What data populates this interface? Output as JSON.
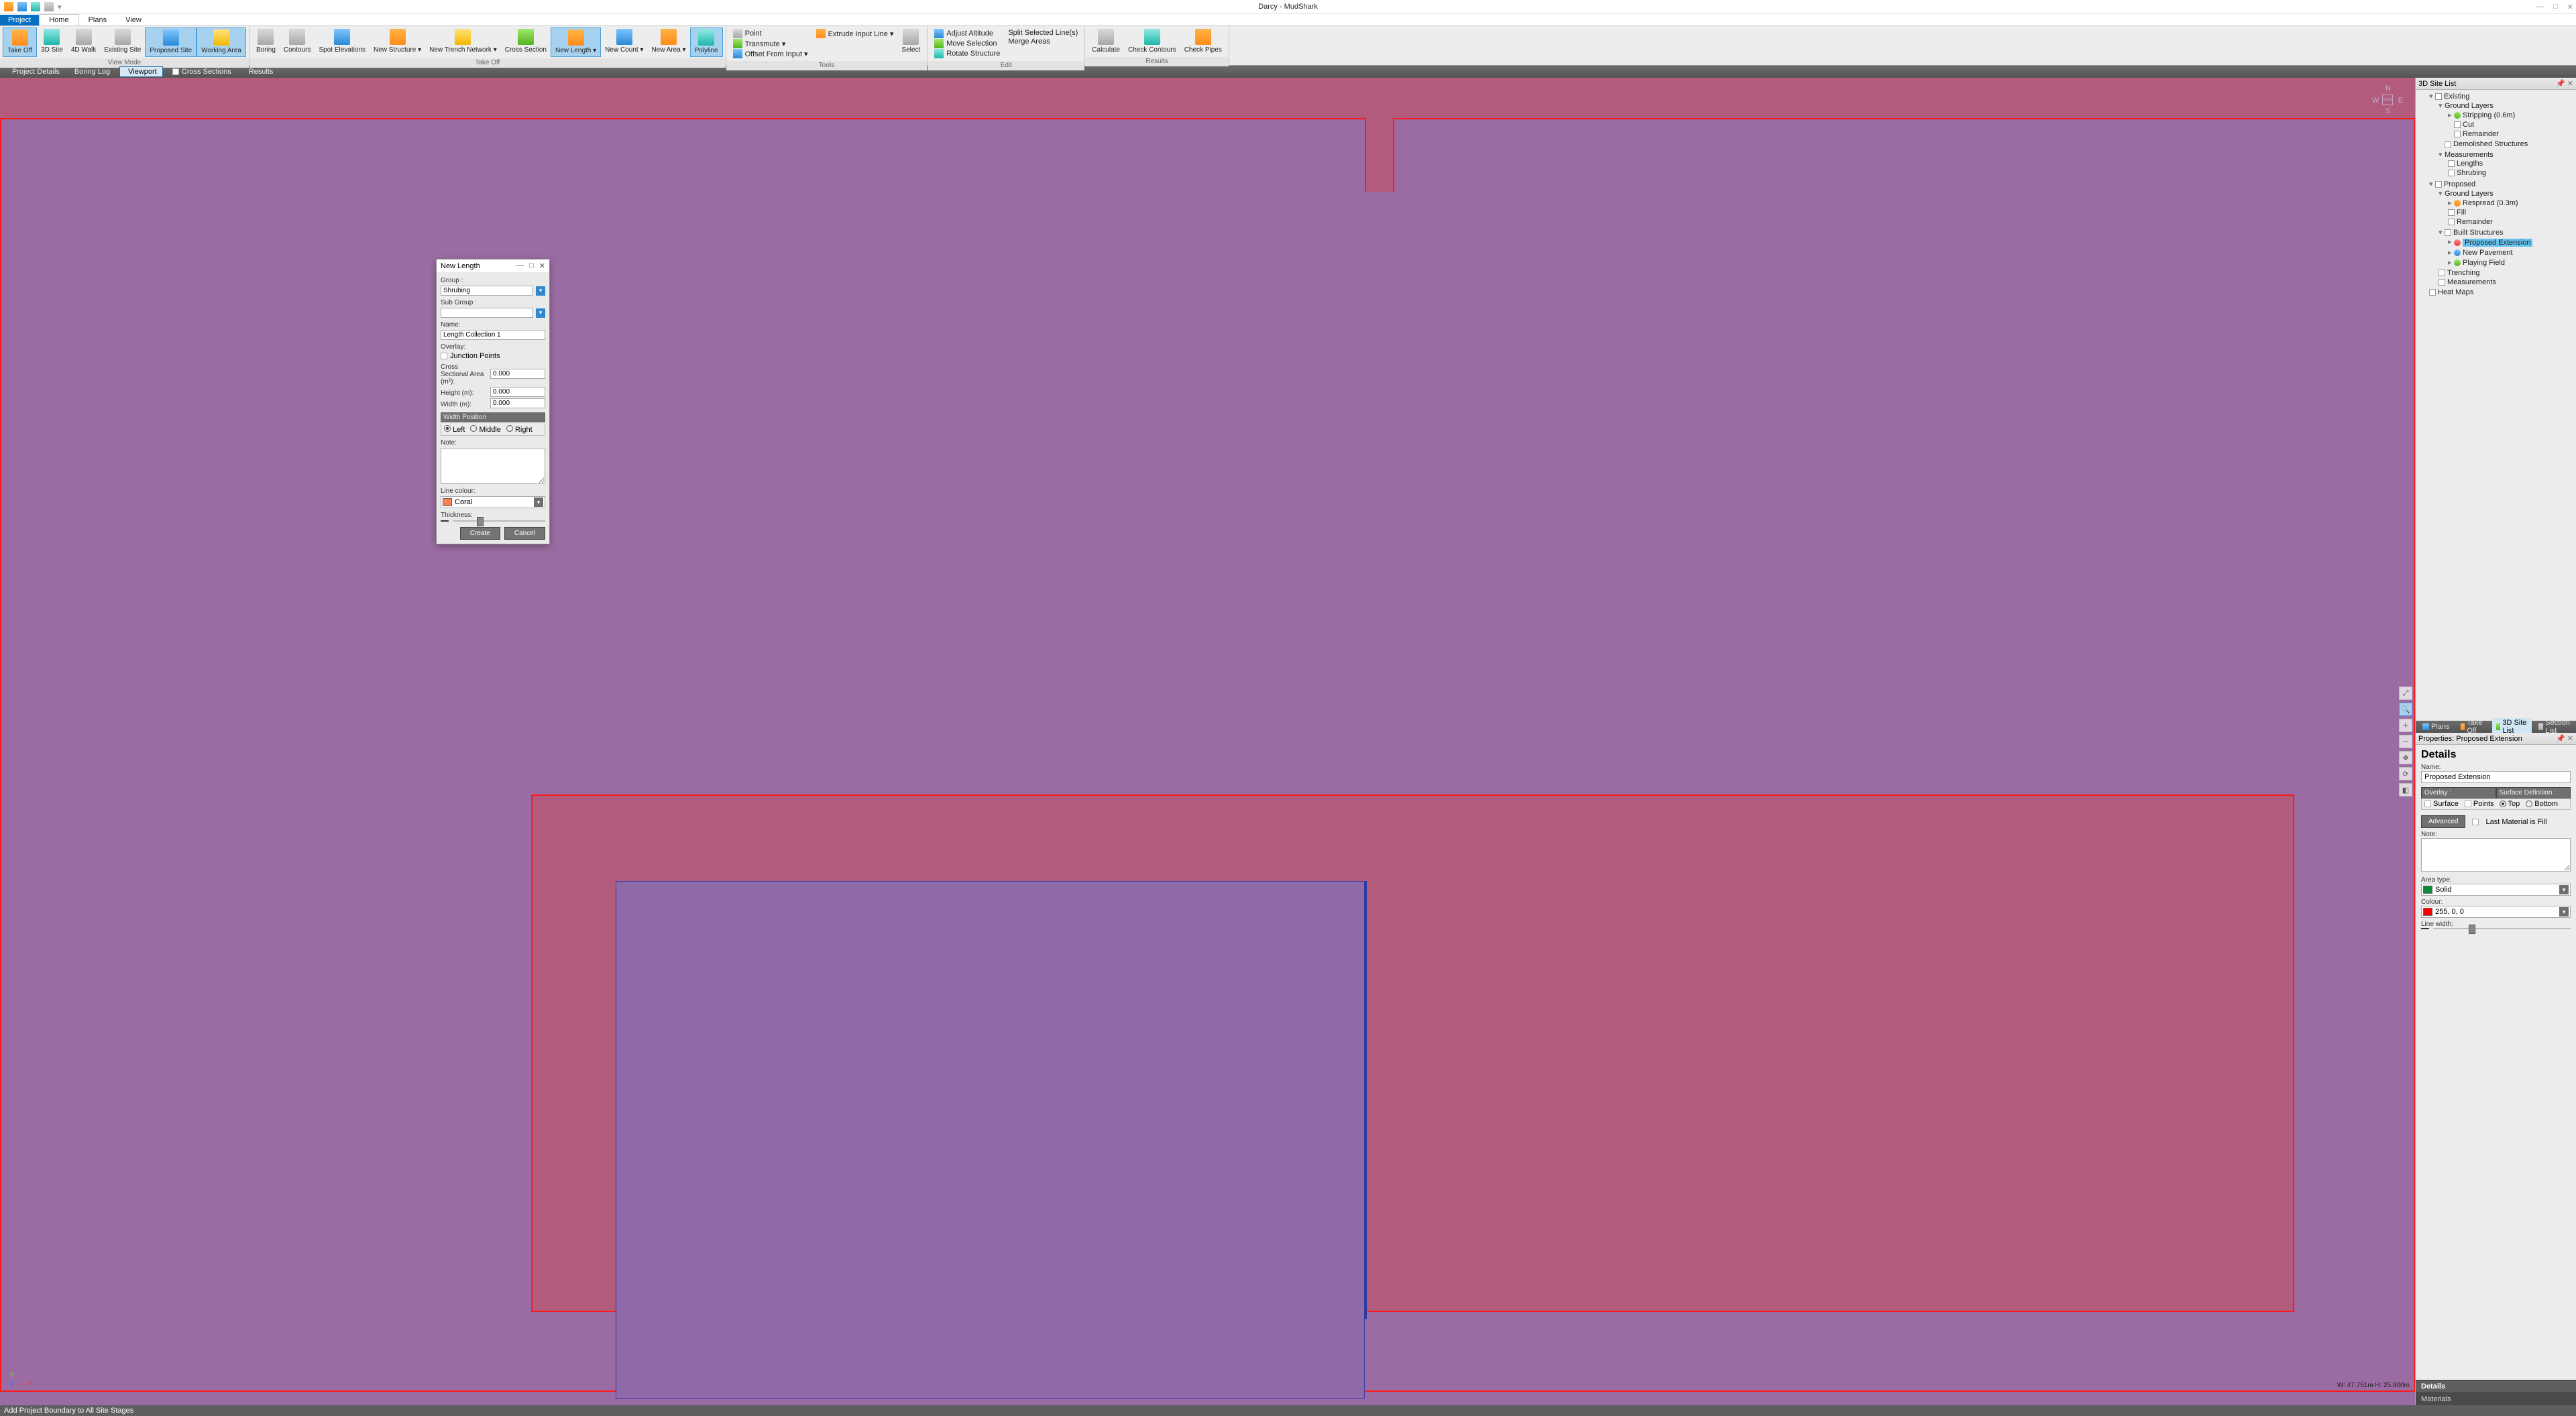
{
  "window": {
    "title": "Darcy - MudShark"
  },
  "menutabs": {
    "project": "Project",
    "home": "Home",
    "plans": "Plans",
    "view": "View"
  },
  "ribbon": {
    "groups": {
      "view_mode": {
        "label": "View Mode",
        "take_off": "Take\nOff",
        "site3d": "3D\nSite",
        "walk4d": "4D\nWalk",
        "existing": "Existing\nSite",
        "proposed": "Proposed\nSite",
        "working": "Working\nArea"
      },
      "take_off": {
        "label": "Take Off",
        "boring": "Boring",
        "contours": "Contours",
        "spot": "Spot\nElevations",
        "structure": "New\nStructure ▾",
        "trench": "New Trench\nNetwork ▾",
        "cross": "Cross\nSection",
        "length": "New\nLength ▾",
        "count": "New\nCount ▾",
        "area": "New\nArea ▾",
        "polyline": "Polyline"
      },
      "tools": {
        "label": "Tools",
        "point": "Point",
        "transmute": "Transmute ▾",
        "offset": "Offset From Input ▾",
        "extrude": "Extrude Input Line ▾",
        "select": "Select"
      },
      "edit": {
        "label": "Edit",
        "adjust": "Adjust Altitude",
        "move": "Move Selection",
        "rotate": "Rotate Structure",
        "split": "Split Selected Line(s)",
        "merge": "Merge Areas"
      },
      "results": {
        "label": "Results",
        "calculate": "Calculate",
        "contours": "Check\nContours",
        "pipes": "Check\nPipes"
      }
    }
  },
  "subtabs": {
    "project_details": "Project Details",
    "boring_log": "Boring Log",
    "viewport": "Viewport",
    "cross_sections": "Cross Sections",
    "results": "Results"
  },
  "compass": {
    "n": "N",
    "e": "E",
    "s": "S",
    "w": "W",
    "c": "TOP"
  },
  "viewport": {
    "coord": "W: 47.751m  H: 25.800m"
  },
  "sitelist": {
    "title": "3D Site List",
    "existing": "Existing",
    "ex_ground": "Ground Layers",
    "stripping": "Stripping (0.6m)",
    "cut": "Cut",
    "remainder": "Remainder",
    "demolished": "Demolished Structures",
    "measurements": "Measurements",
    "lengths": "Lengths",
    "shrubing": "Shrubing",
    "proposed": "Proposed",
    "pr_ground": "Ground Layers",
    "respread": "Respread (0.3m)",
    "fill": "Fill",
    "pr_remainder": "Remainder",
    "built": "Built Structures",
    "ext": "Proposed Extension",
    "pavement": "New Pavement",
    "field": "Playing Field",
    "trenching": "Trenching",
    "pr_meas": "Measurements",
    "heat": "Heat Maps"
  },
  "side_tabs": {
    "plans": "Plans",
    "take_off": "Take Off",
    "site3d": "3D Site List",
    "sections": "Section List"
  },
  "props": {
    "header": "Properties: Proposed Extension",
    "details": "Details",
    "name_label": "Name:",
    "name_value": "Proposed Extension",
    "overlay_hd": "Overlay :",
    "surface_def_hd": "Surface Definition :",
    "surface": "Surface",
    "points": "Points",
    "top": "Top",
    "bottom": "Bottom",
    "advanced": "Advanced",
    "last_mat": "Last Material is Fill",
    "note": "Note:",
    "area_type": "Area type:",
    "area_value": "Solid",
    "colour": "Colour:",
    "colour_value": "255, 0, 0",
    "line_width": "Line width:"
  },
  "bottom_tabs": {
    "details": "Details",
    "materials": "Materials"
  },
  "status": {
    "text": "Add Project Boundary to All Site Stages"
  },
  "dialog": {
    "title": "New Length",
    "group": "Group :",
    "group_value": "Shrubing",
    "subgroup": "Sub Group :",
    "subgroup_value": "",
    "name": "Name:",
    "name_value": "Length Collection 1",
    "overlay": "Overlay:",
    "junction": "Junction Points",
    "csa": "Cross Sectional Area (m²):",
    "csa_value": "0.000",
    "height": "Height (m):",
    "height_value": "0.000",
    "width": "Width (m):",
    "width_value": "0.000",
    "widthpos_hd": "Width Position",
    "left": "Left",
    "middle": "Middle",
    "right": "Right",
    "note": "Note:",
    "line_colour": "Line colour:",
    "line_colour_value": "Coral",
    "thickness": "Thickness:",
    "create": "Create",
    "cancel": "Cancel"
  }
}
